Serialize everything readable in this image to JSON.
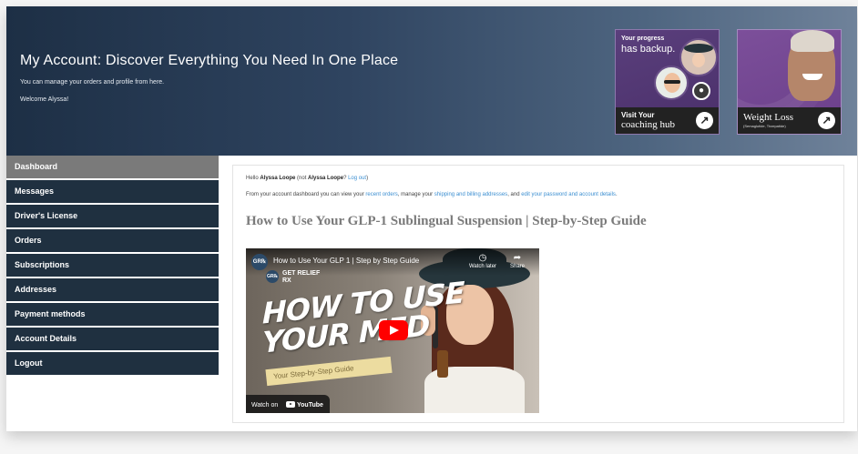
{
  "header": {
    "title": "My Account: Discover Everything You Need In One Place",
    "subtitle": "You can manage your orders and profile from here.",
    "welcome": "Welcome Alyssa!"
  },
  "promos": {
    "coaching": {
      "tag1": "Your progress",
      "tag2": "has backup.",
      "cta_line1": "Visit Your",
      "cta_line2": "coaching hub"
    },
    "weight_loss": {
      "title": "Weight Loss",
      "subtitle": "(Semaglutide, Tirzepatide)"
    }
  },
  "sidebar": {
    "items": [
      {
        "label": "Dashboard",
        "active": true
      },
      {
        "label": "Messages"
      },
      {
        "label": "Driver's License"
      },
      {
        "label": "Orders"
      },
      {
        "label": "Subscriptions"
      },
      {
        "label": "Addresses"
      },
      {
        "label": "Payment methods"
      },
      {
        "label": "Account Details"
      },
      {
        "label": "Logout"
      }
    ]
  },
  "main": {
    "hello_prefix": "Hello ",
    "user_name": "Alyssa Loope",
    "not_prefix": " (not ",
    "not_user": "Alyssa Loope",
    "not_suffix": "? ",
    "logout_link": "Log out",
    "close_paren": ")",
    "intro_1": "From your account dashboard you can view your ",
    "recent_orders_link": "recent orders",
    "intro_2": ", manage your ",
    "addresses_link": "shipping and billing addresses",
    "intro_3": ", and ",
    "password_link": "edit your password and account details",
    "intro_4": ".",
    "video_heading": "How to Use Your GLP-1 Sublingual Suspension | Step-by-Step Guide"
  },
  "video": {
    "channel_badge": "GR℞",
    "title": "How to Use Your GLP 1 | Step by Step Guide",
    "watch_later": "Watch later",
    "share": "Share",
    "brand_badge": "GR℞",
    "brand_line1": "GET RELIEF",
    "brand_line2": "RX",
    "big_line1": "HOW TO USE",
    "big_line2": "YOUR MED",
    "strip_text": "Your Step-by-Step Guide",
    "watch_on": "Watch on",
    "youtube": "YouTube"
  },
  "colors": {
    "header_dark": "#1d2f45",
    "sidebar_bg": "#1f3040",
    "sidebar_active": "#7a7a7a",
    "link": "#3c8fd1",
    "play_red": "#ff0000"
  }
}
